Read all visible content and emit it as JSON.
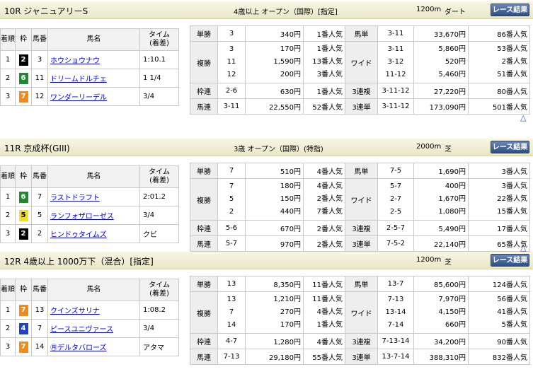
{
  "header_labels": {
    "pos": "着順",
    "frame": "枠",
    "num": "馬番",
    "horse": "馬名",
    "time": "タイム\n(着差)",
    "button": "レース結果",
    "back_to_top": "△"
  },
  "colors": {
    "frame2": "#000000",
    "frame4": "#1f43c6",
    "frame5": "#f0e028",
    "frame6": "#1e8a32",
    "frame7": "#f08a18"
  },
  "races": [
    {
      "title": "10R ジャニュアリーS",
      "conditions": "4歳以上 オープン（国際）[指定]",
      "distance": "1200m",
      "surface": "ダート",
      "results": [
        {
          "pos": "1",
          "frame": "2",
          "num": "3",
          "horse": "ホウショウナウ",
          "time": "1:10.1"
        },
        {
          "pos": "2",
          "frame": "6",
          "num": "11",
          "horse": "ドリームドルチェ",
          "time": "1 1/4"
        },
        {
          "pos": "3",
          "frame": "7",
          "num": "12",
          "horse": "ワンダーリーデル",
          "time": "3/4"
        }
      ],
      "payouts": {
        "tansho": {
          "label": "単勝",
          "combos": [
            "3"
          ],
          "yen": [
            "340円"
          ],
          "pop": [
            "1番人気"
          ]
        },
        "fukusho": {
          "label": "複勝",
          "combos": [
            "3",
            "11",
            "12"
          ],
          "yen": [
            "170円",
            "1,590円",
            "200円"
          ],
          "pop": [
            "1番人気",
            "13番人気",
            "3番人気"
          ]
        },
        "wakuren": {
          "label": "枠連",
          "combos": [
            "2-6"
          ],
          "yen": [
            "630円"
          ],
          "pop": [
            "1番人気"
          ]
        },
        "umaren": {
          "label": "馬連",
          "combos": [
            "3-11"
          ],
          "yen": [
            "22,550円"
          ],
          "pop": [
            "52番人気"
          ]
        },
        "umatan": {
          "label": "馬単",
          "combos": [
            "3-11"
          ],
          "yen": [
            "33,670円"
          ],
          "pop": [
            "86番人気"
          ]
        },
        "wide": {
          "label": "ワイド",
          "combos": [
            "3-11",
            "3-12",
            "11-12"
          ],
          "yen": [
            "5,860円",
            "520円",
            "5,460円"
          ],
          "pop": [
            "53番人気",
            "2番人気",
            "51番人気"
          ]
        },
        "sanrenpuku": {
          "label": "3連複",
          "combos": [
            "3-11-12"
          ],
          "yen": [
            "27,220円"
          ],
          "pop": [
            "80番人気"
          ]
        },
        "sanrentan": {
          "label": "3連単",
          "combos": [
            "3-11-12"
          ],
          "yen": [
            "173,090円"
          ],
          "pop": [
            "501番人気"
          ]
        }
      }
    },
    {
      "title": "11R 京成杯(GIII)",
      "conditions": "3歳 オープン（国際）(特指)",
      "distance": "2000m",
      "surface": "芝",
      "results": [
        {
          "pos": "1",
          "frame": "6",
          "num": "7",
          "horse": "ラストドラフト",
          "time": "2:01.2"
        },
        {
          "pos": "2",
          "frame": "5",
          "num": "5",
          "horse": "ランフォザローゼス",
          "time": "3/4"
        },
        {
          "pos": "3",
          "frame": "2",
          "num": "2",
          "horse": "ヒンドゥタイムズ",
          "time": "クビ"
        }
      ],
      "payouts": {
        "tansho": {
          "label": "単勝",
          "combos": [
            "7"
          ],
          "yen": [
            "510円"
          ],
          "pop": [
            "4番人気"
          ]
        },
        "fukusho": {
          "label": "複勝",
          "combos": [
            "7",
            "5",
            "2"
          ],
          "yen": [
            "180円",
            "150円",
            "440円"
          ],
          "pop": [
            "4番人気",
            "2番人気",
            "7番人気"
          ]
        },
        "wakuren": {
          "label": "枠連",
          "combos": [
            "5-6"
          ],
          "yen": [
            "670円"
          ],
          "pop": [
            "2番人気"
          ]
        },
        "umaren": {
          "label": "馬連",
          "combos": [
            "5-7"
          ],
          "yen": [
            "970円"
          ],
          "pop": [
            "2番人気"
          ]
        },
        "umatan": {
          "label": "馬単",
          "combos": [
            "7-5"
          ],
          "yen": [
            "1,690円"
          ],
          "pop": [
            "3番人気"
          ]
        },
        "wide": {
          "label": "ワイド",
          "combos": [
            "5-7",
            "2-7",
            "2-5"
          ],
          "yen": [
            "400円",
            "1,670円",
            "1,080円"
          ],
          "pop": [
            "3番人気",
            "22番人気",
            "15番人気"
          ]
        },
        "sanrenpuku": {
          "label": "3連複",
          "combos": [
            "2-5-7"
          ],
          "yen": [
            "5,490円"
          ],
          "pop": [
            "17番人気"
          ]
        },
        "sanrentan": {
          "label": "3連単",
          "combos": [
            "7-5-2"
          ],
          "yen": [
            "22,140円"
          ],
          "pop": [
            "65番人気"
          ]
        }
      }
    },
    {
      "title": "12R 4歳以上 1000万下（混合）[指定]",
      "conditions": "",
      "distance": "1200m",
      "surface": "芝",
      "results": [
        {
          "pos": "1",
          "frame": "7",
          "num": "13",
          "horse": "クインズサリナ",
          "time": "1:08.2"
        },
        {
          "pos": "2",
          "frame": "4",
          "num": "7",
          "horse": "ピースユニヴァース",
          "time": "3/4"
        },
        {
          "pos": "3",
          "frame": "7",
          "num": "14",
          "horse": "㊊デルタバローズ",
          "time": "アタマ"
        }
      ],
      "payouts": {
        "tansho": {
          "label": "単勝",
          "combos": [
            "13"
          ],
          "yen": [
            "8,350円"
          ],
          "pop": [
            "11番人気"
          ]
        },
        "fukusho": {
          "label": "複勝",
          "combos": [
            "13",
            "7",
            "14"
          ],
          "yen": [
            "1,210円",
            "270円",
            "170円"
          ],
          "pop": [
            "11番人気",
            "4番人気",
            "1番人気"
          ]
        },
        "wakuren": {
          "label": "枠連",
          "combos": [
            "4-7"
          ],
          "yen": [
            "1,280円"
          ],
          "pop": [
            "4番人気"
          ]
        },
        "umaren": {
          "label": "馬連",
          "combos": [
            "7-13"
          ],
          "yen": [
            "29,180円"
          ],
          "pop": [
            "55番人気"
          ]
        },
        "umatan": {
          "label": "馬単",
          "combos": [
            "13-7"
          ],
          "yen": [
            "85,600円"
          ],
          "pop": [
            "124番人気"
          ]
        },
        "wide": {
          "label": "ワイド",
          "combos": [
            "7-13",
            "13-14",
            "7-14"
          ],
          "yen": [
            "7,970円",
            "4,150円",
            "660円"
          ],
          "pop": [
            "56番人気",
            "41番人気",
            "5番人気"
          ]
        },
        "sanrenpuku": {
          "label": "3連複",
          "combos": [
            "7-13-14"
          ],
          "yen": [
            "34,200円"
          ],
          "pop": [
            "90番人気"
          ]
        },
        "sanrentan": {
          "label": "3連単",
          "combos": [
            "13-7-14"
          ],
          "yen": [
            "388,310円"
          ],
          "pop": [
            "832番人気"
          ]
        }
      }
    }
  ]
}
